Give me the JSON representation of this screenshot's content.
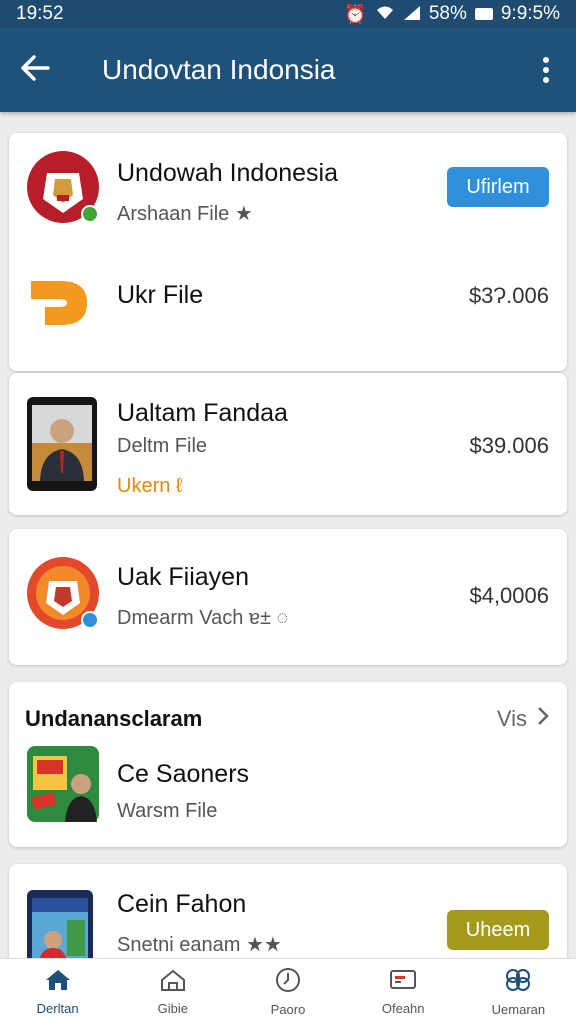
{
  "status_bar": {
    "time": "19:52",
    "battery_percent": "58%",
    "clock_right": "9:9:5%"
  },
  "app_bar": {
    "title": "Undovtan Indonsia"
  },
  "items": [
    {
      "name": "Undowah Indonesia",
      "sub": "Arshaan File ★",
      "action_label": "Ufirlem"
    },
    {
      "name": "Ukr File",
      "price": "$3Ɂ.006"
    },
    {
      "name": "Ualtam Fandaa",
      "sub": "Deltm File",
      "price": "$39.006",
      "tag": "Ukern ℓ"
    },
    {
      "name": "Uak Fiiayen",
      "sub": "Dmearm Vach ɐ± ◌",
      "price": "$4,0006"
    }
  ],
  "section": {
    "title": "Undanansclaram",
    "view_all": "Vis",
    "items": [
      {
        "name": "Ce Saoners",
        "sub": "Warsm File"
      },
      {
        "name": "Cein Fahon",
        "sub": "Snetni eanam ★★",
        "action_label": "Uheem"
      }
    ]
  },
  "bottom_nav": [
    {
      "label": "Derltan",
      "icon": "home-icon"
    },
    {
      "label": "Gibie",
      "icon": "house-outline-icon"
    },
    {
      "label": "Paoro",
      "icon": "clock-icon"
    },
    {
      "label": "Ofeahn",
      "icon": "card-icon"
    },
    {
      "label": "Uemaran",
      "icon": "flower-icon"
    }
  ],
  "colors": {
    "app_bar": "#1f527a",
    "status_bar": "#1e4b6f",
    "primary_button": "#2e8fdc",
    "olive_button": "#a39a1c",
    "tag_orange": "#e08b00"
  }
}
